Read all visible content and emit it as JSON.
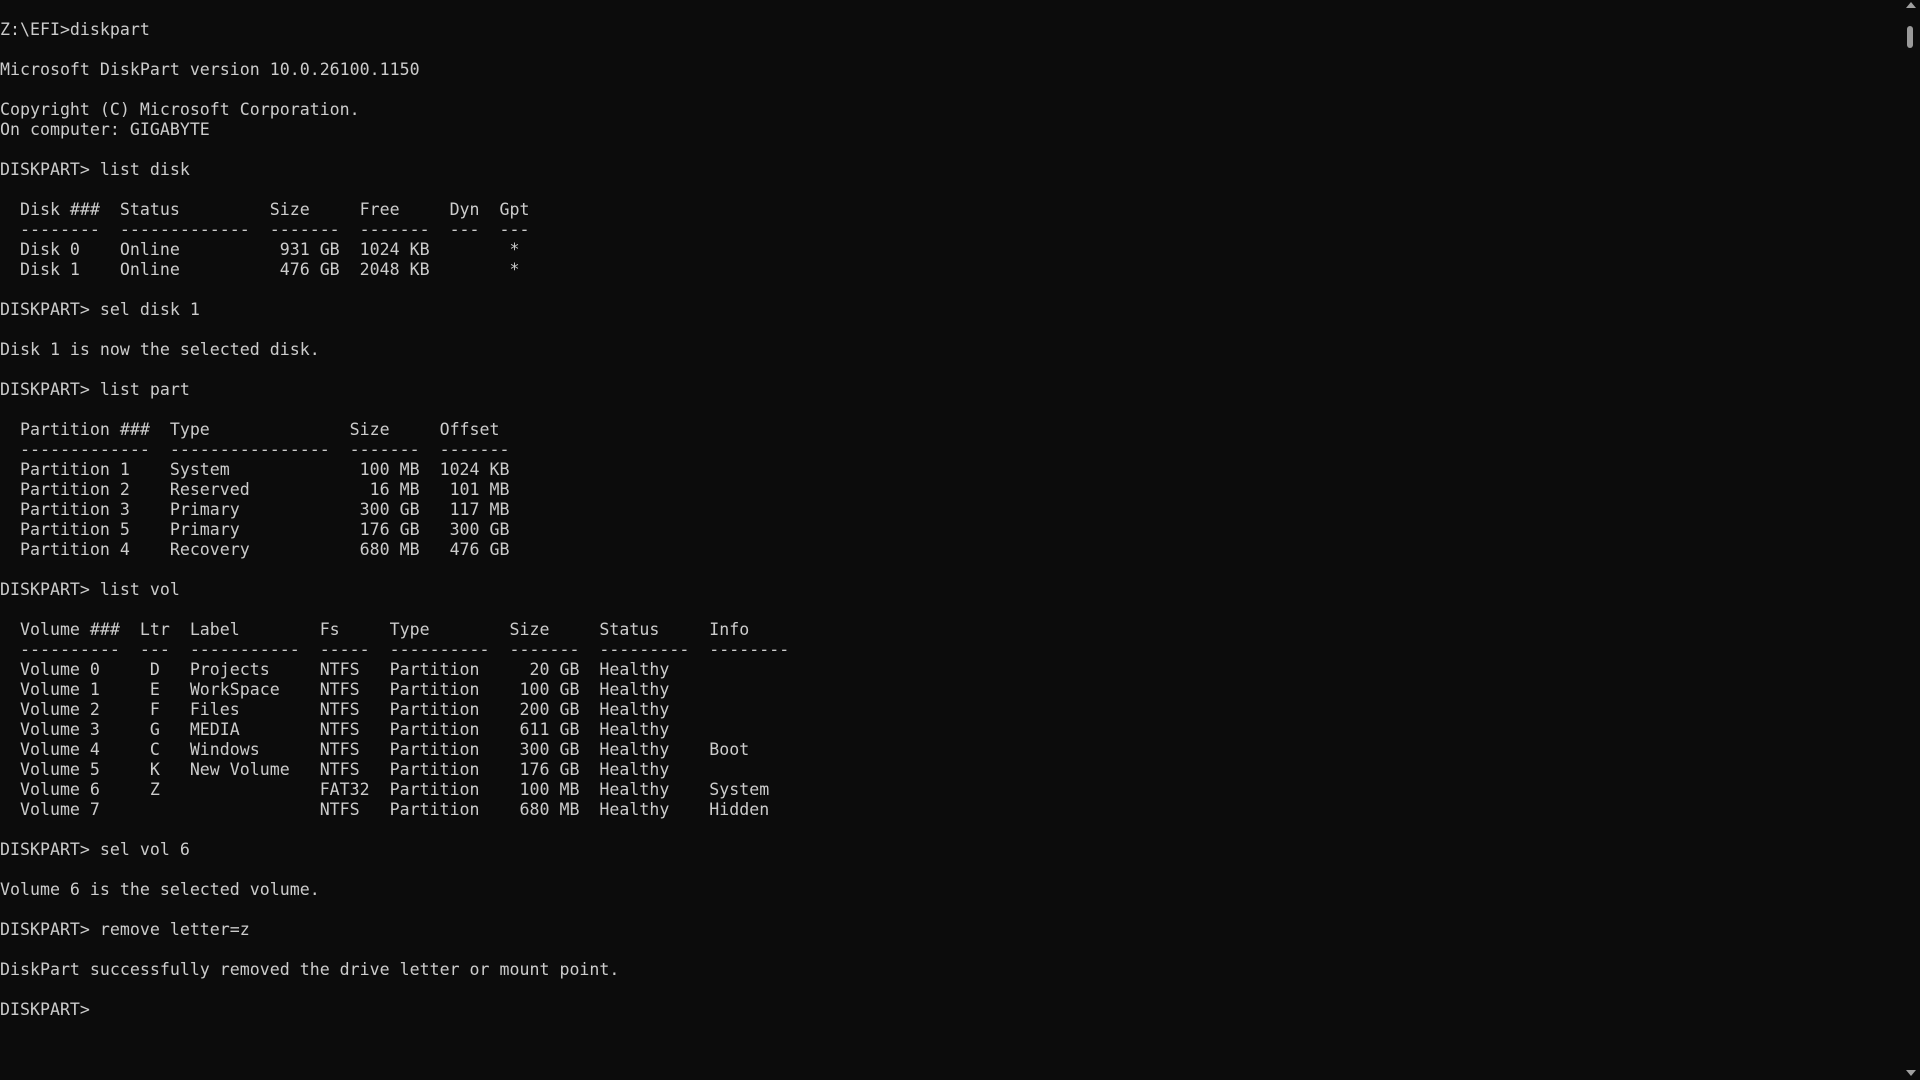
{
  "console": {
    "lines": [
      "Z:\\EFI>diskpart",
      "",
      "Microsoft DiskPart version 10.0.26100.1150",
      "",
      "Copyright (C) Microsoft Corporation.",
      "On computer: GIGABYTE",
      "",
      "DISKPART> list disk",
      "",
      "  Disk ###  Status         Size     Free     Dyn  Gpt",
      "  --------  -------------  -------  -------  ---  ---",
      "  Disk 0    Online          931 GB  1024 KB        *",
      "  Disk 1    Online          476 GB  2048 KB        *",
      "",
      "DISKPART> sel disk 1",
      "",
      "Disk 1 is now the selected disk.",
      "",
      "DISKPART> list part",
      "",
      "  Partition ###  Type              Size     Offset",
      "  -------------  ----------------  -------  -------",
      "  Partition 1    System             100 MB  1024 KB",
      "  Partition 2    Reserved            16 MB   101 MB",
      "  Partition 3    Primary            300 GB   117 MB",
      "  Partition 5    Primary            176 GB   300 GB",
      "  Partition 4    Recovery           680 MB   476 GB",
      "",
      "DISKPART> list vol",
      "",
      "  Volume ###  Ltr  Label        Fs     Type        Size     Status     Info",
      "  ----------  ---  -----------  -----  ----------  -------  ---------  --------",
      "  Volume 0     D   Projects     NTFS   Partition     20 GB  Healthy",
      "  Volume 1     E   WorkSpace    NTFS   Partition    100 GB  Healthy",
      "  Volume 2     F   Files        NTFS   Partition    200 GB  Healthy",
      "  Volume 3     G   MEDIA        NTFS   Partition    611 GB  Healthy",
      "  Volume 4     C   Windows      NTFS   Partition    300 GB  Healthy    Boot",
      "  Volume 5     K   New Volume   NTFS   Partition    176 GB  Healthy",
      "  Volume 6     Z                FAT32  Partition    100 MB  Healthy    System",
      "  Volume 7                      NTFS   Partition    680 MB  Healthy    Hidden",
      "",
      "DISKPART> sel vol 6",
      "",
      "Volume 6 is the selected volume.",
      "",
      "DISKPART> remove letter=z",
      "",
      "DiskPart successfully removed the drive letter or mount point.",
      "",
      "DISKPART> "
    ]
  },
  "scrollbar": {
    "up_icon": "arrow-up-icon",
    "down_icon": "arrow-down-icon"
  },
  "colors": {
    "background": "#0c0c0c",
    "text": "#cccccc",
    "scrollbar": "#9a9a9a"
  }
}
